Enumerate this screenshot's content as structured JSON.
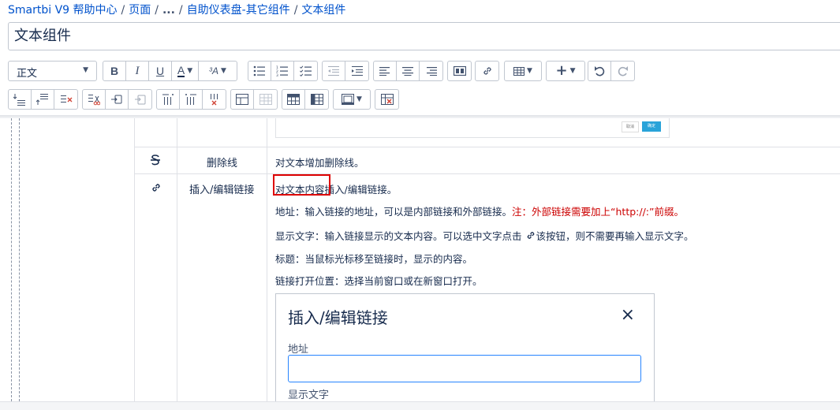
{
  "breadcrumb": {
    "items": [
      "Smartbi V9 帮助中心",
      "页面",
      "...",
      "自助仪表盘-其它组件",
      "文本组件"
    ],
    "separator": "/"
  },
  "page_title": "文本组件",
  "toolbar": {
    "style_select_value": "正文",
    "row1_icons": [
      "bold-icon",
      "italic-icon",
      "underline-icon",
      "text-color-icon",
      "text-format-more-icon",
      "bullet-list-icon",
      "numbered-list-icon",
      "task-list-icon",
      "outdent-icon",
      "indent-icon",
      "align-left-icon",
      "align-center-icon",
      "align-right-icon",
      "page-layout-icon",
      "link-icon",
      "table-icon",
      "insert-more-icon",
      "undo-icon",
      "redo-icon"
    ],
    "row2_icons": [
      "insert-row-before-icon",
      "insert-row-after-icon",
      "delete-row-icon",
      "cut-row-icon",
      "copy-row-icon",
      "paste-row-icon",
      "insert-column-before-icon",
      "insert-column-after-icon",
      "delete-column-icon",
      "merge-cells-icon",
      "split-cells-icon",
      "header-row-icon",
      "header-column-icon",
      "cell-color-icon",
      "delete-table-icon"
    ]
  },
  "table": {
    "rows": [
      {
        "icon": "strikethrough-icon",
        "name": "删除线",
        "desc": "对文本增加删除线。"
      },
      {
        "icon": "link-icon",
        "name": "插入/编辑链接",
        "lines": [
          {
            "text": "对文本内容插入/编辑链接。"
          },
          {
            "text": "地址：输入链接的地址，可以是内部链接和外部链接。",
            "red": "注：外部链接需要加上“http://:”前缀。"
          },
          {
            "text": "显示文字：输入链接显示的文本内容。可以选中文字点击",
            "text2": "该按钮，则不需要再输入显示文字。"
          },
          {
            "text": "标题：当鼠标光标移至链接时，显示的内容。"
          },
          {
            "text": "链接打开位置：选择当前窗口或在新窗口打开。"
          }
        ]
      }
    ],
    "mini_form": {
      "cancel": "取消",
      "ok": "确定"
    }
  },
  "dialog": {
    "title": "插入/编辑链接",
    "close": "×",
    "address_label": "地址",
    "address_value": "",
    "display_text_label": "显示文字"
  }
}
